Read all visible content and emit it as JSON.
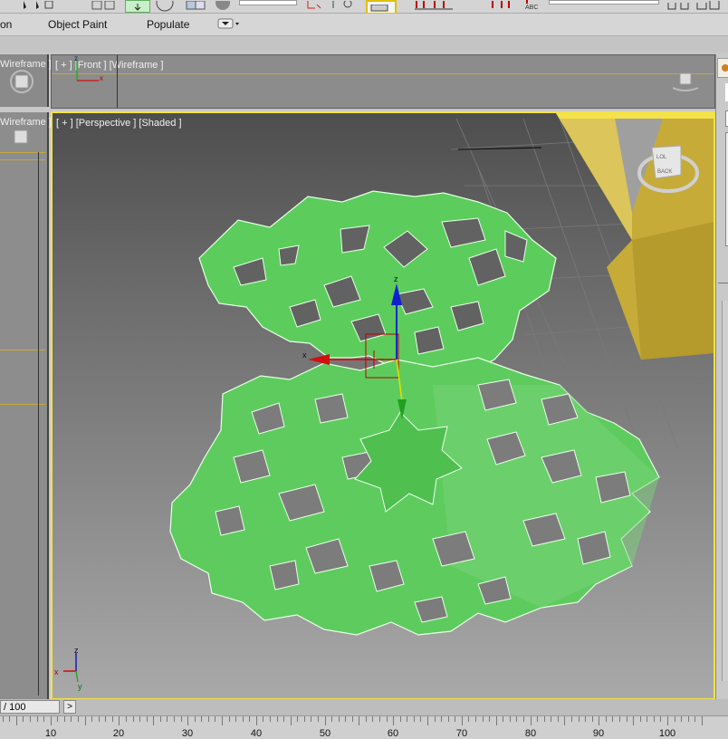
{
  "ribbon": {
    "tabs": [
      "on",
      "Object Paint",
      "Populate"
    ]
  },
  "viewports": {
    "left_top_label": "Wireframe ]",
    "front_label": "[ + ] [Front ] [Wireframe ]",
    "left_bottom_label": "Wireframe ]",
    "perspective_label": "[ + ] [Perspective ] [Shaded ]"
  },
  "viewcube": {
    "top_face": "LOL",
    "front_face": "BACK"
  },
  "axes": {
    "x": "x",
    "y": "y",
    "z": "z"
  },
  "timeline": {
    "frame_value": "/ 100",
    "next_label": ">",
    "ruler_labels": [
      "10",
      "20",
      "30",
      "40",
      "50",
      "60",
      "70",
      "80",
      "90",
      "100"
    ]
  },
  "colors": {
    "viewport_active_border": "#f3e24a",
    "mesh_green": "#5ccc5c",
    "mesh_edge": "#e8ffe8",
    "box_yellow": "#c9ad3a"
  }
}
